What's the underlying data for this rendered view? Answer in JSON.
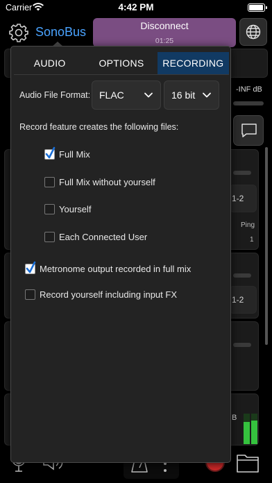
{
  "status_bar": {
    "carrier": "Carrier",
    "time": "4:42 PM"
  },
  "header": {
    "app_name": "SonoBus",
    "connect_button": {
      "label": "Disconnect",
      "elapsed": "01:25"
    }
  },
  "background": {
    "level_text": "-INF dB",
    "route_label_1": "1-2",
    "route_label_2": "1-2",
    "ping_label": "Ping",
    "ping_value": "1",
    "meter_label": "B"
  },
  "popup": {
    "tabs": [
      {
        "label": "AUDIO",
        "active": false
      },
      {
        "label": "OPTIONS",
        "active": false
      },
      {
        "label": "RECORDING",
        "active": true
      }
    ],
    "format_label": "Audio File Format:",
    "format_value": "FLAC",
    "bit_depth_value": "16 bit",
    "description": "Record feature creates the following files:",
    "file_options": [
      {
        "label": "Full Mix",
        "checked": true
      },
      {
        "label": "Full Mix without yourself",
        "checked": false
      },
      {
        "label": "Yourself",
        "checked": false
      },
      {
        "label": "Each Connected User",
        "checked": false
      }
    ],
    "metronome_option": {
      "label": "Metronome output recorded in full mix",
      "checked": true
    },
    "input_fx_option": {
      "label": "Record yourself including input FX",
      "checked": false
    }
  },
  "colors": {
    "accent": "#4aa3ff",
    "connect_button": "#7a4d82",
    "active_tab": "#113a63",
    "record_button": "#d42a2a",
    "meter_green": "#35c23e"
  },
  "icons": [
    "wifi-icon",
    "battery-icon",
    "settings-gear-icon",
    "globe-icon",
    "chat-icon",
    "microphone-icon",
    "speaker-icon",
    "metronome-icon",
    "more-icon",
    "record-icon",
    "folder-icon",
    "chevron-down-icon",
    "checkmark-icon"
  ]
}
